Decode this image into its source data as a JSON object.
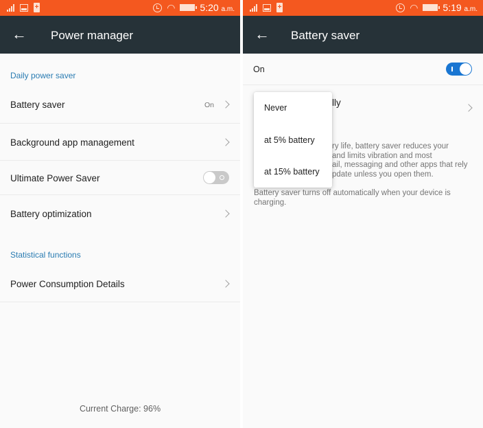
{
  "left_screen": {
    "status_bar": {
      "time": "5:20",
      "ampm": "a.m.",
      "charging_symbol": "+"
    },
    "app_bar": {
      "title": "Power manager",
      "back_icon": "←"
    },
    "sections": [
      {
        "header": "Daily power saver",
        "items": [
          {
            "label": "Battery saver",
            "value": "On",
            "control": "chevron"
          },
          {
            "label": "Background app management",
            "control": "chevron"
          },
          {
            "label": "Ultimate Power Saver",
            "control": "toggle",
            "toggle_state": "off"
          },
          {
            "label": "Battery optimization",
            "control": "chevron"
          }
        ]
      },
      {
        "header": "Statistical functions",
        "items": [
          {
            "label": "Power Consumption Details",
            "control": "chevron"
          }
        ]
      }
    ],
    "footer": "Current Charge: 96%"
  },
  "right_screen": {
    "status_bar": {
      "time": "5:19",
      "ampm": "a.m.",
      "charging_symbol": "+"
    },
    "app_bar": {
      "title": "Battery saver",
      "back_icon": "←"
    },
    "master_switch": {
      "label": "On",
      "state": "on"
    },
    "turn_on_row_partial_label": "lly",
    "description_partial_lines": [
      "ry life, battery saver reduces your",
      "and limits vibration and most",
      "ail, messaging and other apps that rely",
      "pdate unless you open them."
    ],
    "description_footer": "Battery saver turns off automatically when your device is charging.",
    "popup_menu": {
      "options": [
        "Never",
        "at 5% battery",
        "at 15% battery"
      ]
    }
  },
  "colors": {
    "status_bar": "#f4581f",
    "app_bar": "#263238",
    "accent_blue": "#1976d2",
    "section_header": "#2a7cb2",
    "background": "#fafafa"
  }
}
